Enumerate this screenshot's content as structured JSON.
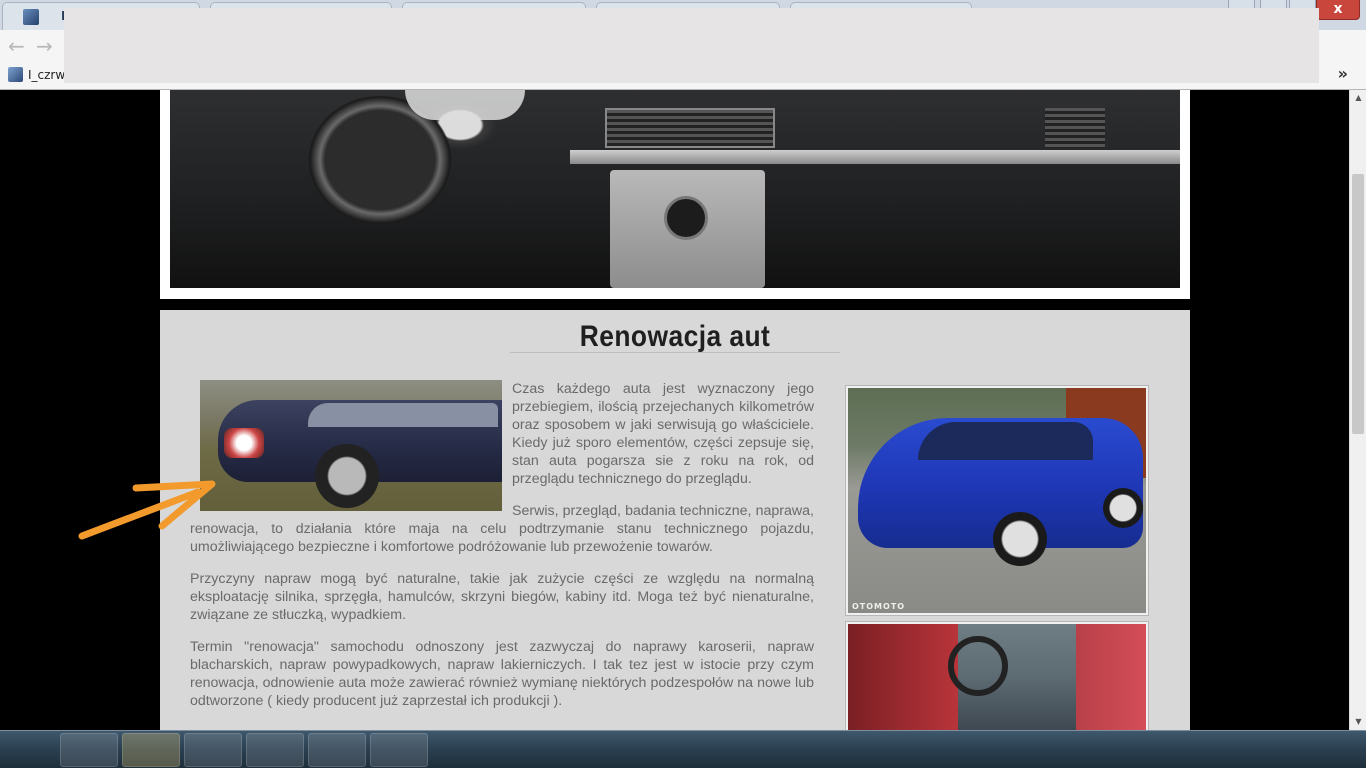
{
  "browser": {
    "tab_label": "I",
    "bookmark_label": "I_czrw",
    "bookmarks_more": "»",
    "close_label": "x",
    "back_icon": "←",
    "forward_icon": "→",
    "menu_icon": "▾"
  },
  "page": {
    "section_title": "Renowacja aut",
    "paragraphs": [
      "Czas każdego auta jest wyznaczony jego przebiegiem, ilością przejechanych kilkometrów oraz sposobem w jaki serwisują go właściciele. Kiedy już sporo elementów, części zepsuje się, stan auta pogarsza sie z roku na rok, od przeglądu technicznego do przeglądu.",
      "Serwis, przegląd, badania techniczne, naprawa, renowacja, to działania które maja na celu podtrzymanie stanu technicznego pojazdu, umożliwiającego bezpieczne i komfortowe podróżowanie lub przewożenie towarów.",
      "Przyczyny napraw mogą być naturalne, takie jak zużycie części ze względu na normalną eksploatację silnika, sprzęgła, hamulców, skrzyni biegów, kabiny itd. Moga też być nienaturalne, związane ze stłuczką, wypadkiem.",
      "Termin \"renowacja\" samochodu odnoszony jest zazwyczaj do naprawy karoserii, napraw blacharskich, napraw powypadkowych, napraw lakierniczych. I tak tez jest w istocie przy czym renowacja, odnowienie auta może zawierać również wymianę niektórych podzespołów na nowe lub odtworzone ( kiedy producent już zaprzestał ich produkcji )."
    ],
    "blue_car_watermark": "OTOMOTO"
  },
  "colors": {
    "accent_arrow": "#f39a2c",
    "content_bg": "#d8d8d8",
    "title": "#1f1f1f",
    "text": "#6a6a6a"
  },
  "icons": [
    "arrow-icon",
    "back-icon",
    "forward-icon",
    "favicon-icon",
    "close-icon"
  ]
}
